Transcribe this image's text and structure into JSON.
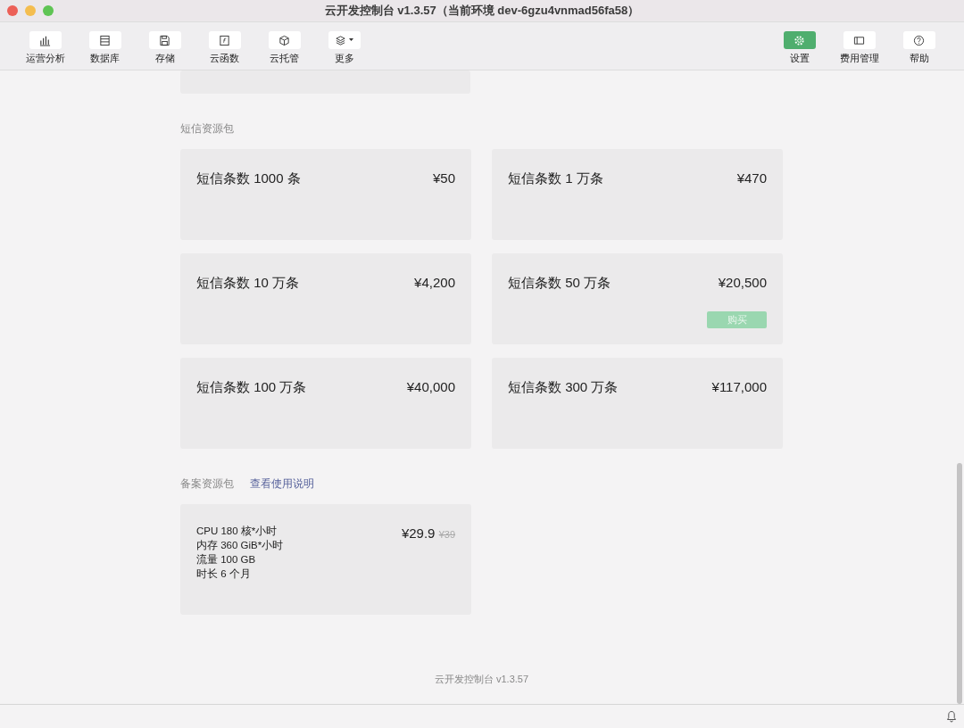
{
  "window": {
    "title": "云开发控制台 v1.3.57（当前环境 dev-6gzu4vnmad56fa58）"
  },
  "toolbar": {
    "left": [
      {
        "label": "运营分析",
        "kind": "chart",
        "selected": false
      },
      {
        "label": "数据库",
        "kind": "table",
        "selected": false
      },
      {
        "label": "存储",
        "kind": "disk",
        "selected": false
      },
      {
        "label": "云函数",
        "kind": "function",
        "selected": false
      },
      {
        "label": "云托管",
        "kind": "cube",
        "selected": false
      },
      {
        "label": "更多",
        "kind": "layers",
        "selected": false,
        "dropdown": true
      }
    ],
    "right": [
      {
        "label": "设置",
        "kind": "gear",
        "selected": true
      },
      {
        "label": "费用管理",
        "kind": "ticket",
        "selected": false
      },
      {
        "label": "帮助",
        "kind": "help",
        "selected": false
      }
    ]
  },
  "sms_section": {
    "title": "短信资源包",
    "packs": [
      {
        "name": "短信条数 1000 条",
        "price": "¥50"
      },
      {
        "name": "短信条数 1 万条",
        "price": "¥470"
      },
      {
        "name": "短信条数 10 万条",
        "price": "¥4,200"
      },
      {
        "name": "短信条数 50 万条",
        "price": "¥20,500",
        "buy_button": "购买"
      },
      {
        "name": "短信条数 100 万条",
        "price": "¥40,000"
      },
      {
        "name": "短信条数 300 万条",
        "price": "¥117,000"
      }
    ]
  },
  "filing_section": {
    "title": "备案资源包",
    "link": "查看使用说明",
    "packs": [
      {
        "lines": [
          "CPU 180 核*小时",
          "内存 360 GiB*小时",
          "流量 100 GB",
          "时长 6 个月"
        ],
        "price": "¥29.9",
        "original_price": "¥39"
      }
    ]
  },
  "footer": "云开发控制台 v1.3.57"
}
